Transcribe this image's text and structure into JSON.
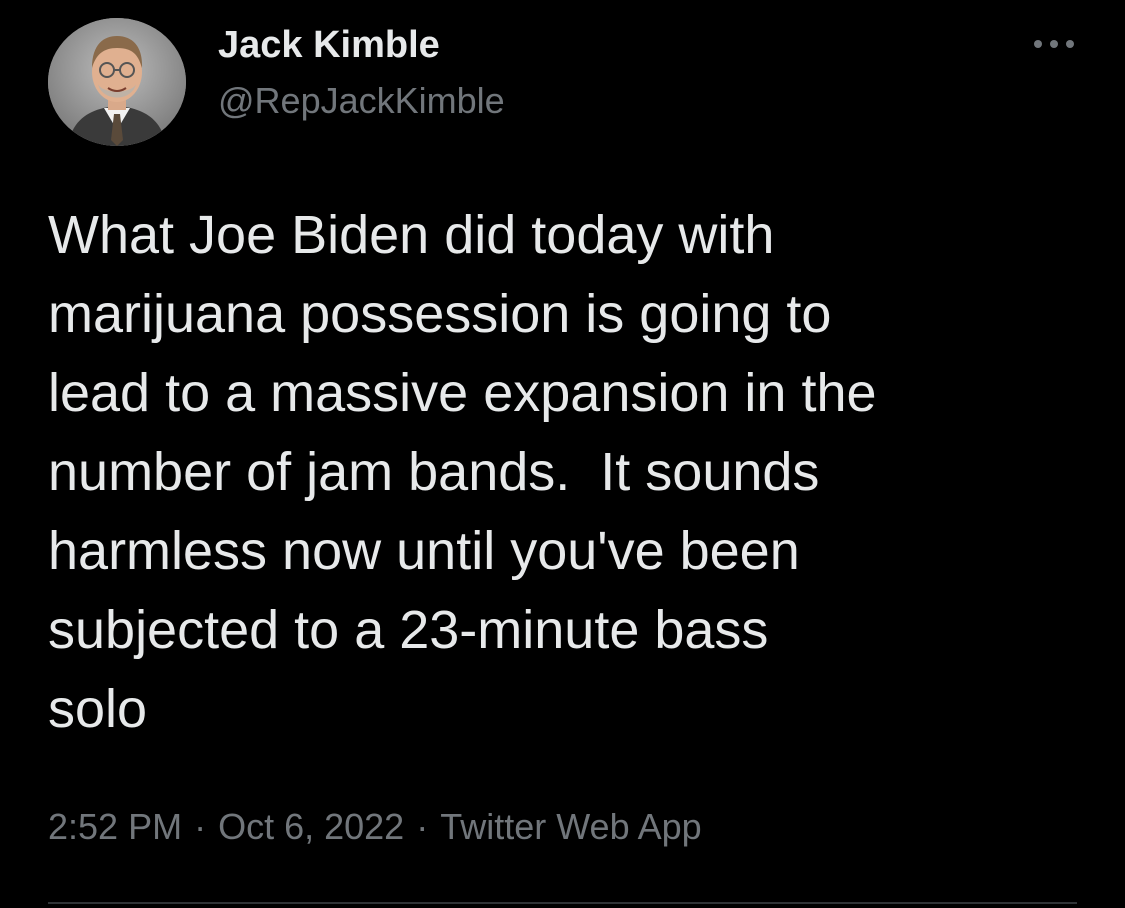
{
  "tweet": {
    "author_name": "Jack Kimble",
    "author_handle": "@RepJackKimble",
    "text": "What Joe Biden did today with\nmarijuana possession is going to\nlead to a massive expansion in the\nnumber of jam bands.  It sounds\nharmless now until you've been\nsubjected to a 23-minute bass\nsolo",
    "time": "2:52 PM",
    "date": "Oct 6, 2022",
    "source": "Twitter Web App",
    "separator": "·"
  },
  "icons": {
    "avatar": "avatar-photo",
    "more": "more-options-icon"
  },
  "colors": {
    "background": "#000000",
    "primary_text": "#e7e9ea",
    "secondary_text": "#71767b",
    "divider": "#2f3336"
  }
}
